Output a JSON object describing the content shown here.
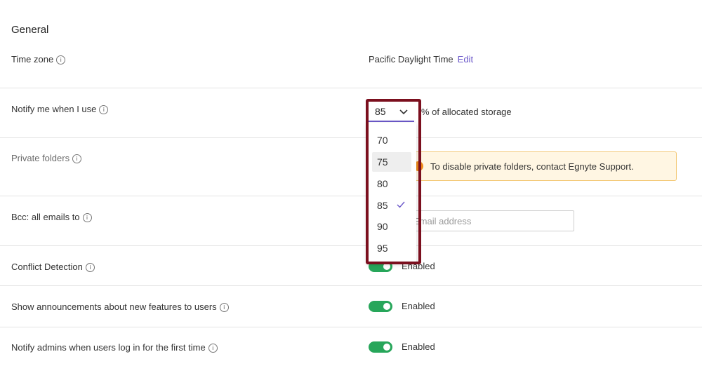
{
  "general": {
    "title": "General"
  },
  "settings": {
    "time_zone": {
      "label": "Time zone",
      "value": "Pacific Daylight Time",
      "edit_label": "Edit"
    },
    "notify_storage": {
      "label": "Notify me when I use",
      "selected": "85",
      "suffix": "% of allocated storage",
      "options": [
        "70",
        "75",
        "80",
        "85",
        "90",
        "95"
      ],
      "hovered_option": "75"
    },
    "private_folders": {
      "label": "Private folders",
      "notice": "To disable private folders, contact Egnyte Support."
    },
    "bcc": {
      "label": "Bcc: all emails to",
      "placeholder": "Email address"
    },
    "conflict_detection": {
      "label": "Conflict Detection",
      "status": "Enabled"
    },
    "announcements": {
      "label": "Show announcements about new features to users",
      "status": "Enabled"
    },
    "notify_admins": {
      "label": "Notify admins when users log in for the first time",
      "status": "Enabled"
    }
  },
  "icons": {
    "info": "info-icon",
    "chevron": "chevron-down-icon",
    "check": "check-icon",
    "warning": "warning-icon"
  },
  "colors": {
    "accent": "#6b58c9",
    "toggle_on": "#27a65a",
    "notice_bg": "#fff6e3",
    "notice_icon": "#f08a19",
    "highlight": "#7b0f1e"
  }
}
